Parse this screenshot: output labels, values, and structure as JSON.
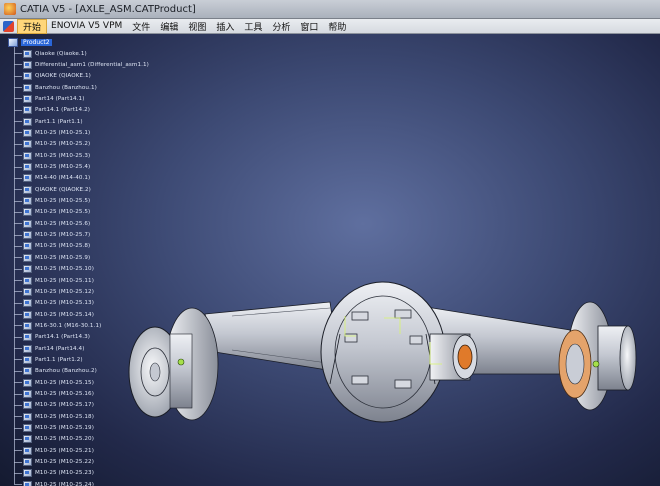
{
  "window": {
    "title": "CATIA V5 - [AXLE_ASM.CATProduct]"
  },
  "menu": {
    "items": [
      "开始",
      "ENOVIA V5 VPM",
      "文件",
      "编辑",
      "视图",
      "插入",
      "工具",
      "分析",
      "窗口",
      "帮助"
    ],
    "active_index": 0
  },
  "tree": {
    "root": "Product2",
    "items": [
      "Qiaoke (Qiaoke.1)",
      "Differential_asm1 (Differential_asm1.1)",
      "QIAOKE (QIAOKE.1)",
      "Banzhou (Banzhou.1)",
      "Part14 (Part14.1)",
      "Part14.1 (Part14.2)",
      "Part1.1 (Part1.1)",
      "M10-25 (M10-25.1)",
      "M10-25 (M10-25.2)",
      "M10-25 (M10-25.3)",
      "M10-25 (M10-25.4)",
      "M14-40 (M14-40.1)",
      "QIAOKE (QIAOKE.2)",
      "M10-25 (M10-25.5)",
      "M10-25 (M10-25.5)",
      "M10-25 (M10-25.6)",
      "M10-25 (M10-25.7)",
      "M10-25 (M10-25.8)",
      "M10-25 (M10-25.9)",
      "M10-25 (M10-25.10)",
      "M10-25 (M10-25.11)",
      "M10-25 (M10-25.12)",
      "M10-25 (M10-25.13)",
      "M10-25 (M10-25.14)",
      "M16-30.1 (M16-30.1.1)",
      "Part14.1 (Part14.3)",
      "Part14 (Part14.4)",
      "Part1.1 (Part1.2)",
      "Banzhou (Banzhou.2)",
      "M10-25 (M10-25.15)",
      "M10-25 (M10-25.16)",
      "M10-25 (M10-25.17)",
      "M10-25 (M10-25.18)",
      "M10-25 (M10-25.19)",
      "M10-25 (M10-25.20)",
      "M10-25 (M10-25.21)",
      "M10-25 (M10-25.22)",
      "M10-25 (M10-25.23)",
      "M10-25 (M10-25.24)"
    ]
  },
  "colors": {
    "background_center": "#5f6f9f",
    "background_edge": "#141a30",
    "part_fill": "#c9cdd6",
    "part_edge": "#1a1d26",
    "selection_highlight": "#2a66d8",
    "hub_orange": "#e07a2a",
    "axis_green": "#a6e04a"
  },
  "icons": [
    "catia-app-icon",
    "start-menu-icon",
    "product-root-icon",
    "part-node-icon"
  ]
}
